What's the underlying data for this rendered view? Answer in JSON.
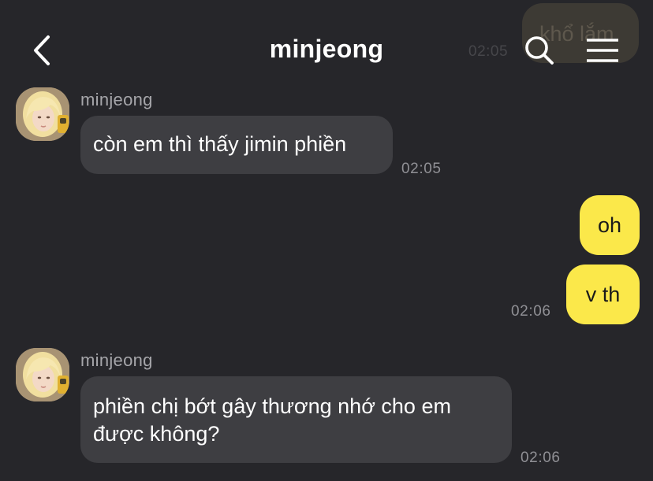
{
  "header": {
    "title": "minjeong",
    "back_icon": "chevron-left-icon",
    "search_icon": "search-icon",
    "menu_icon": "menu-icon"
  },
  "background_message": {
    "text": "khổ lắm",
    "time": "02:05"
  },
  "messages": [
    {
      "direction": "incoming",
      "sender": "minjeong",
      "lines": [
        "còn em thì thấy jimin phiền"
      ],
      "time": "02:05"
    },
    {
      "direction": "outgoing",
      "lines": [
        "oh"
      ],
      "time": ""
    },
    {
      "direction": "outgoing",
      "lines": [
        "v th"
      ],
      "time": "02:06"
    },
    {
      "direction": "incoming",
      "sender": "minjeong",
      "lines": [
        "phiền chị bớt gây thương nhớ cho em",
        "được không?"
      ],
      "time": "02:06"
    }
  ],
  "colors": {
    "background": "#26262a",
    "incoming_bubble": "#3e3e42",
    "outgoing_bubble": "#fbe84a",
    "timestamp": "#909095"
  }
}
